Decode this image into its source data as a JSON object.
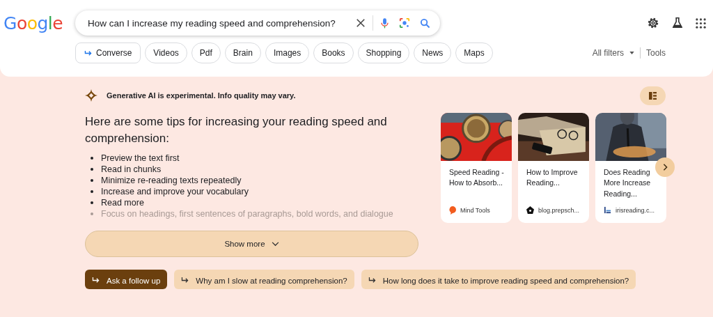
{
  "logo": "Google",
  "search": {
    "value": "How can I increase my reading speed and comprehension?"
  },
  "chips": [
    {
      "label": "Converse",
      "kind": "converse"
    },
    {
      "label": "Videos",
      "kind": "plain"
    },
    {
      "label": "Pdf",
      "kind": "plain"
    },
    {
      "label": "Brain",
      "kind": "plain"
    },
    {
      "label": "Images",
      "kind": "plain"
    },
    {
      "label": "Books",
      "kind": "plain"
    },
    {
      "label": "Shopping",
      "kind": "plain"
    },
    {
      "label": "News",
      "kind": "plain"
    },
    {
      "label": "Maps",
      "kind": "plain"
    }
  ],
  "filters": {
    "all_filters": "All filters",
    "tools": "Tools"
  },
  "ai": {
    "notice": "Generative AI is experimental. Info quality may vary.",
    "heading": "Here are some tips for increasing your reading speed and comprehension:",
    "tips": [
      {
        "text": "Preview the text first",
        "faded": false
      },
      {
        "text": "Read in chunks",
        "faded": false
      },
      {
        "text": "Minimize re-reading texts repeatedly",
        "faded": false
      },
      {
        "text": "Increase and improve your vocabulary",
        "faded": false
      },
      {
        "text": "Read more",
        "faded": false
      },
      {
        "text": "Focus on headings, first sentences of paragraphs, bold words, and dialogue",
        "faded": true
      }
    ],
    "show_more": "Show more",
    "sources": [
      {
        "title": "Speed Reading - How to Absorb...",
        "site": "Mind Tools"
      },
      {
        "title": "How to Improve Reading...",
        "site": "blog.prepsch..."
      },
      {
        "title": "Does Reading More Increase Reading...",
        "site": "irisreading.c..."
      }
    ]
  },
  "followups": [
    {
      "label": "Ask a follow up",
      "kind": "primary"
    },
    {
      "label": "Why am I slow at reading comprehension?",
      "kind": "suggestion"
    },
    {
      "label": "How long does it take to improve reading speed and comprehension?",
      "kind": "suggestion"
    }
  ]
}
